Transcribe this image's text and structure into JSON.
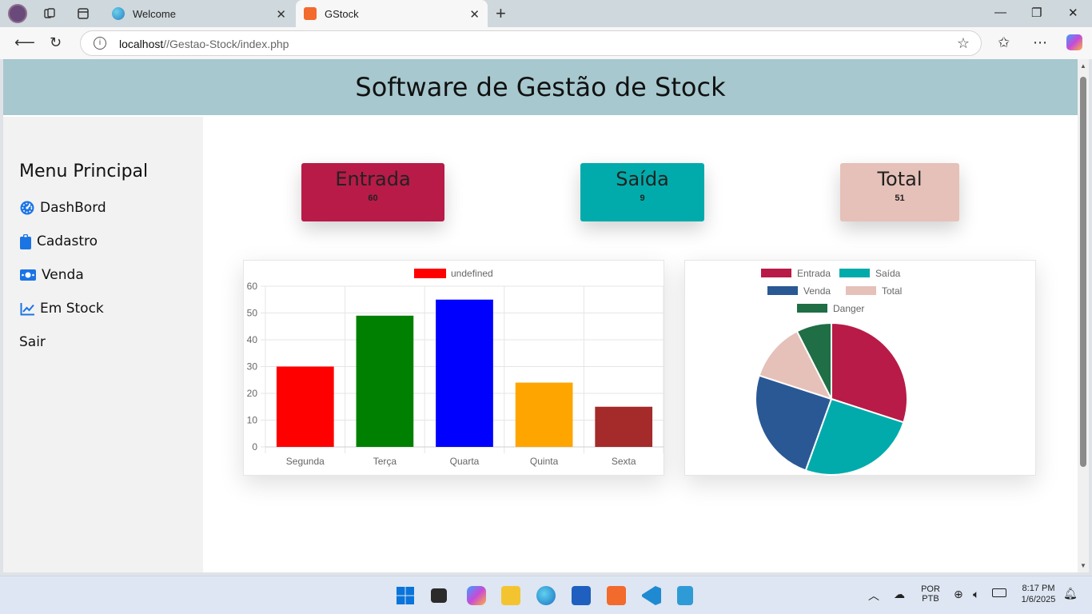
{
  "browser": {
    "tabs": [
      {
        "label": "Welcome",
        "active": false
      },
      {
        "label": "GStock",
        "active": true
      }
    ],
    "url_host": "localhost",
    "url_path": "//Gestao-Stock/index.php"
  },
  "page": {
    "title": "Software de Gestão de Stock",
    "sidebar": {
      "heading": "Menu Principal",
      "items": [
        {
          "label": "DashBord",
          "icon": "dashboard-gauge-icon"
        },
        {
          "label": "Cadastro",
          "icon": "clipboard-icon"
        },
        {
          "label": "Venda",
          "icon": "money-bill-icon"
        },
        {
          "label": "Em Stock",
          "icon": "line-chart-icon"
        },
        {
          "label": "Sair",
          "icon": ""
        }
      ]
    },
    "cards": [
      {
        "title": "Entrada",
        "value": "60",
        "color": "#b81b48"
      },
      {
        "title": "Saída",
        "value": "9",
        "color": "#02abab"
      },
      {
        "title": "Total",
        "value": "51",
        "color": "#e6c1b9"
      }
    ]
  },
  "chart_data": [
    {
      "type": "bar",
      "legend": [
        "undefined"
      ],
      "legend_color": "#ff0000",
      "categories": [
        "Segunda",
        "Terça",
        "Quarta",
        "Quinta",
        "Sexta"
      ],
      "values": [
        30,
        49,
        55,
        24,
        15
      ],
      "colors": [
        "#ff0000",
        "#008000",
        "#0000ff",
        "#ffa500",
        "#a52a2a"
      ],
      "ylim": [
        0,
        60
      ],
      "yticks": [
        0,
        10,
        20,
        30,
        40,
        50,
        60
      ],
      "grid": true,
      "legend_position": "top"
    },
    {
      "type": "pie",
      "labels": [
        "Entrada",
        "Saída",
        "Venda",
        "Total",
        "Danger"
      ],
      "values": [
        60,
        51,
        49,
        25,
        15
      ],
      "colors": [
        "#b81b48",
        "#02abab",
        "#2a5894",
        "#e6c1b9",
        "#1f6e45"
      ],
      "legend_position": "top"
    }
  ],
  "taskbar": {
    "lang_top": "POR",
    "lang_bottom": "PTB",
    "time": "8:17 PM",
    "date": "1/6/2025"
  }
}
